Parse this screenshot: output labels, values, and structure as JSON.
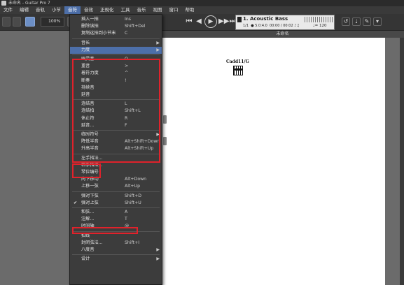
{
  "titlebar": {
    "title": "未命名 - Guitar Pro 7"
  },
  "menubar": [
    "文件",
    "编辑",
    "音轨",
    "小节",
    "音符",
    "音效",
    "正规化",
    "工具",
    "音乐",
    "视图",
    "窗口",
    "帮助"
  ],
  "menubar_active": "音符",
  "toolbar": {
    "zoom": "100%"
  },
  "transport": {
    "buttons": [
      "⏮",
      "◀",
      "▶",
      "▶▶",
      "⏭"
    ]
  },
  "lcd": {
    "track": "1. Acoustic Bass",
    "position": "1/1",
    "time_sig": "5.0:4.0",
    "time": "00:00 / 00:02",
    "tempo": "♩= 120",
    "note_icon": "♪♫"
  },
  "right_tools": [
    "↺",
    "♩",
    "✎",
    "▾"
  ],
  "document": {
    "tab_title": "未命名",
    "chord_name": "Cadd11/G"
  },
  "menu": {
    "items": [
      {
        "label": "插入一拍",
        "shortcut": "Ins",
        "arrow": false
      },
      {
        "label": "删除该拍",
        "shortcut": "Shift+Del",
        "arrow": false
      },
      {
        "label": "复制这拍到小节末",
        "shortcut": "C",
        "arrow": false
      },
      {
        "sep": true
      },
      {
        "label": "音长",
        "shortcut": "",
        "arrow": true
      },
      {
        "label": "力度",
        "shortcut": "",
        "arrow": true,
        "highlight": true
      },
      {
        "sep": true
      },
      {
        "label": "幽灵音",
        "shortcut": "O",
        "arrow": false
      },
      {
        "label": "重音",
        "shortcut": ">",
        "arrow": false
      },
      {
        "label": "着符力度",
        "shortcut": "^",
        "arrow": false
      },
      {
        "label": "断奏",
        "shortcut": "!",
        "arrow": false
      },
      {
        "label": "持续音",
        "shortcut": "",
        "arrow": false
      },
      {
        "label": "延音",
        "shortcut": "",
        "arrow": false
      },
      {
        "sep": true
      },
      {
        "label": "连结音",
        "shortcut": "L",
        "arrow": false
      },
      {
        "label": "连结拍",
        "shortcut": "Shift+L",
        "arrow": false
      },
      {
        "label": "休止符",
        "shortcut": "R",
        "arrow": false
      },
      {
        "label": "延音...",
        "shortcut": "F",
        "arrow": false
      },
      {
        "sep": true
      },
      {
        "label": "临时符号",
        "shortcut": "",
        "arrow": true
      },
      {
        "label": "降低半音",
        "shortcut": "Alt+Shift+Down",
        "arrow": false
      },
      {
        "label": "升高半音",
        "shortcut": "Alt+Shift+Up",
        "arrow": false
      },
      {
        "sep": true
      },
      {
        "label": "左手指法...",
        "shortcut": "",
        "arrow": false
      },
      {
        "label": "右手指法...",
        "shortcut": "",
        "arrow": false
      },
      {
        "label": "琴位编号",
        "shortcut": "",
        "arrow": false
      },
      {
        "label": "向下移动",
        "shortcut": "Alt+Down",
        "arrow": false
      },
      {
        "label": "上移一弦",
        "shortcut": "Alt+Up",
        "arrow": false
      },
      {
        "sep": true
      },
      {
        "label": "弹对下弦",
        "shortcut": "Shift+D",
        "arrow": false
      },
      {
        "label": "弹对上弦",
        "shortcut": "Shift+U",
        "arrow": false,
        "check": true
      },
      {
        "sep": true
      },
      {
        "label": "和弦...",
        "shortcut": "A",
        "arrow": false
      },
      {
        "label": "注解...",
        "shortcut": "T",
        "arrow": false
      },
      {
        "label": "时间轴",
        "shortcut": "@",
        "arrow": false
      },
      {
        "sep": true
      },
      {
        "label": "拍线",
        "shortcut": "",
        "arrow": false
      },
      {
        "label": "封闭弦法...",
        "shortcut": "Shift+I",
        "arrow": false
      },
      {
        "label": "八度音",
        "shortcut": "",
        "arrow": true
      },
      {
        "sep": true
      },
      {
        "label": "设计",
        "shortcut": "",
        "arrow": true
      }
    ]
  },
  "colors": {
    "highlight": "#4d6fa9",
    "annotation": "#e0222b",
    "menu_bg": "#3c3c3c"
  }
}
